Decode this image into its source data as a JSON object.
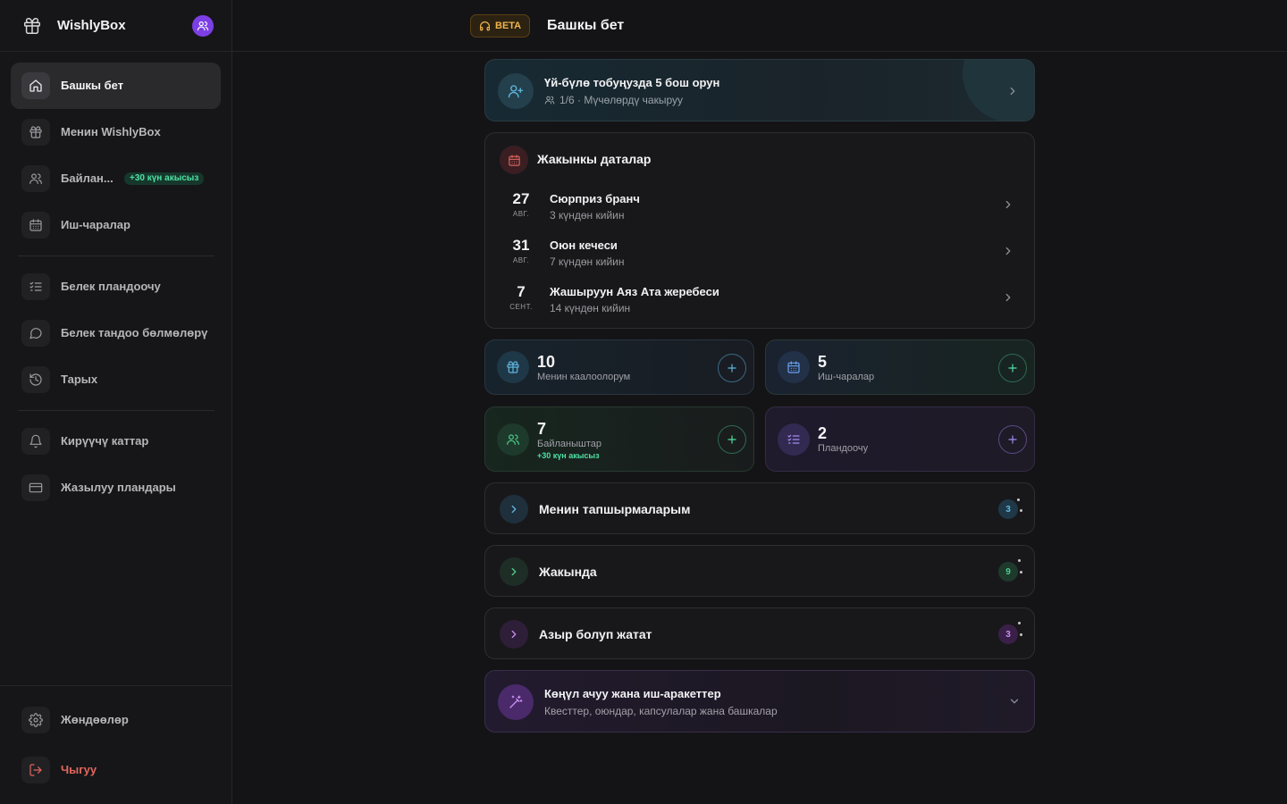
{
  "sidebar": {
    "brand": "WishlyBox",
    "items": [
      {
        "label": "Башкы бет",
        "icon": "home-icon"
      },
      {
        "label": "Менин WishlyBox",
        "icon": "gift-icon"
      },
      {
        "label": "Байлан...",
        "icon": "users-icon",
        "badge": "+30 күн акысыз"
      },
      {
        "label": "Иш-чаралар",
        "icon": "calendar-icon"
      },
      {
        "label": "Белек пландоочу",
        "icon": "checklist-icon"
      },
      {
        "label": "Белек тандоо бөлмөлөрү",
        "icon": "chat-icon"
      },
      {
        "label": "Тарых",
        "icon": "history-icon"
      },
      {
        "label": "Кирүүчү каттар",
        "icon": "bell-icon"
      },
      {
        "label": "Жазылуу пландары",
        "icon": "credit-card-icon"
      }
    ],
    "settings": "Жөндөөлөр",
    "logout": "Чыгуу"
  },
  "header": {
    "beta": "BETA",
    "title": "Башкы бет"
  },
  "family": {
    "title": "Үй-бүлө тобуңузда 5 бош орун",
    "sub": "1/6 · Мүчөлөрдү чакыруу"
  },
  "dates": {
    "title": "Жакынкы даталар",
    "items": [
      {
        "day": "27",
        "month": "АВГ.",
        "name": "Сюрприз бранч",
        "sub": "3 күндөн кийин"
      },
      {
        "day": "31",
        "month": "АВГ.",
        "name": "Оюн кечеси",
        "sub": "7 күндөн кийин"
      },
      {
        "day": "7",
        "month": "СЕНТ.",
        "name": "Жашыруун Аяз Ата жеребеси",
        "sub": "14 күндөн кийин"
      }
    ]
  },
  "stats": {
    "wishes": {
      "num": "10",
      "label": "Менин каалоолорум"
    },
    "events": {
      "num": "5",
      "label": "Иш-чаралар"
    },
    "contacts": {
      "num": "7",
      "label": "Байланыштар",
      "extra": "+30 күн акысыз"
    },
    "planner": {
      "num": "2",
      "label": "Пландоочу"
    }
  },
  "sections": [
    {
      "title": "Менин тапшырмаларым",
      "count": "3"
    },
    {
      "title": "Жакында",
      "count": "9"
    },
    {
      "title": "Азыр болуп жатат",
      "count": "3"
    }
  ],
  "fun": {
    "title": "Көңүл ачуу жана иш-аракеттер",
    "sub": "Квесттер, оюндар, капсулалар жана башкалар"
  },
  "colors": {
    "accent_purple": "#7b3fe4",
    "beta_amber": "#f0b44c",
    "green": "#4ee0a4",
    "red": "#e2675f"
  }
}
